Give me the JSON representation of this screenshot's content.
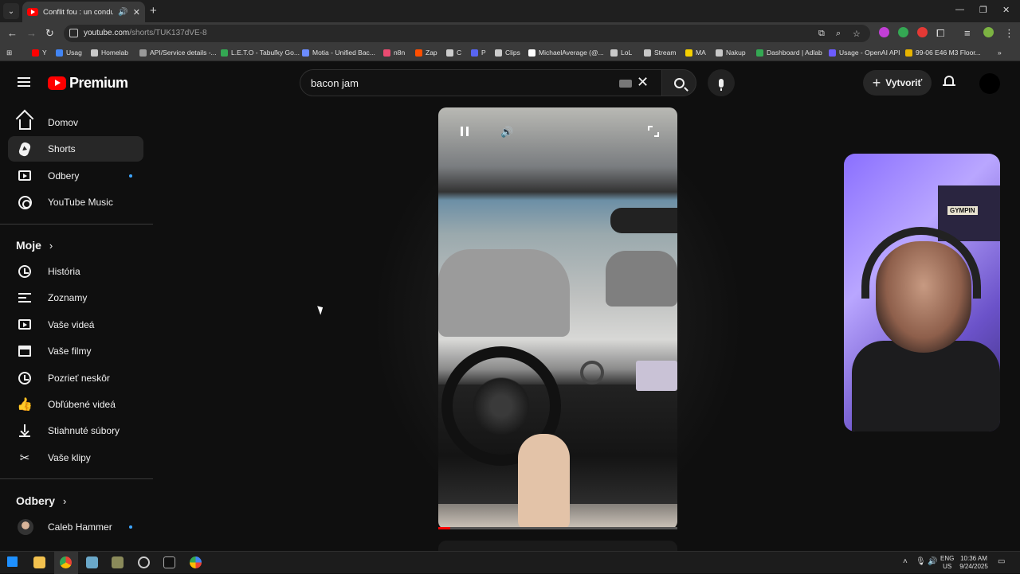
{
  "browser": {
    "tab_title": "Conflit fou : un conducteur",
    "url_host": "youtube.com",
    "url_path": "/shorts/TUK137dVE-8",
    "bookmarks": [
      {
        "label": "Y",
        "color": "#ff0000"
      },
      {
        "label": "Usag",
        "color": "#4285f4"
      },
      {
        "label": "Homelab",
        "color": "#c8c8c8"
      },
      {
        "label": "API/Service details -...",
        "color": "#999999"
      },
      {
        "label": "L.E.T.O - Tabuľky Go...",
        "color": "#34a853"
      },
      {
        "label": "Motia - Unified Bac...",
        "color": "#6c8cff"
      },
      {
        "label": "n8n",
        "color": "#ea4b71"
      },
      {
        "label": "Zap",
        "color": "#ff4f00"
      },
      {
        "label": "C",
        "color": "#cccccc"
      },
      {
        "label": "P",
        "color": "#5865f2"
      },
      {
        "label": "Clips",
        "color": "#cccccc"
      },
      {
        "label": "MichaelAverage (@...",
        "color": "#ffffff"
      },
      {
        "label": "LoL",
        "color": "#c8c8c8"
      },
      {
        "label": "Stream",
        "color": "#c8c8c8"
      },
      {
        "label": "MA",
        "color": "#f5d000"
      },
      {
        "label": "Nakup",
        "color": "#c8c8c8"
      },
      {
        "label": "Dashboard | Adlab",
        "color": "#34a853"
      },
      {
        "label": "Usage - OpenAI API",
        "color": "#6c5cff"
      },
      {
        "label": "99-06 E46 M3 Floor...",
        "color": "#e8b400"
      }
    ]
  },
  "header": {
    "logo_text": "Premium",
    "search_query": "bacon jam",
    "create_label": "Vytvoriť"
  },
  "sidebar": {
    "main": [
      {
        "label": "Domov",
        "icon": "home-icon"
      },
      {
        "label": "Shorts",
        "icon": "shorts-icon",
        "active": true
      },
      {
        "label": "Odbery",
        "icon": "subscriptions-icon",
        "dot": true
      },
      {
        "label": "YouTube Music",
        "icon": "music-icon"
      }
    ],
    "you_heading": "Moje",
    "you": [
      {
        "label": "História",
        "icon": "history-icon"
      },
      {
        "label": "Zoznamy",
        "icon": "playlists-icon"
      },
      {
        "label": "Vaše videá",
        "icon": "your-videos-icon"
      },
      {
        "label": "Vaše filmy",
        "icon": "your-movies-icon"
      },
      {
        "label": "Pozrieť neskôr",
        "icon": "watch-later-icon"
      },
      {
        "label": "Obľúbené videá",
        "icon": "liked-icon"
      },
      {
        "label": "Stiahnuté súbory",
        "icon": "downloads-icon"
      },
      {
        "label": "Vaše klipy",
        "icon": "clips-icon"
      }
    ],
    "subs_heading": "Odbery",
    "subs": [
      {
        "label": "Caleb Hammer",
        "dot": true
      }
    ]
  },
  "player": {
    "progress": 0.05,
    "accent": "#ff0000"
  },
  "webcam": {
    "sign_text": "GYMPIN"
  },
  "taskbar": {
    "lang_top": "ENG",
    "lang_bottom": "US",
    "time": "10:36 AM",
    "date": "9/24/2025"
  }
}
